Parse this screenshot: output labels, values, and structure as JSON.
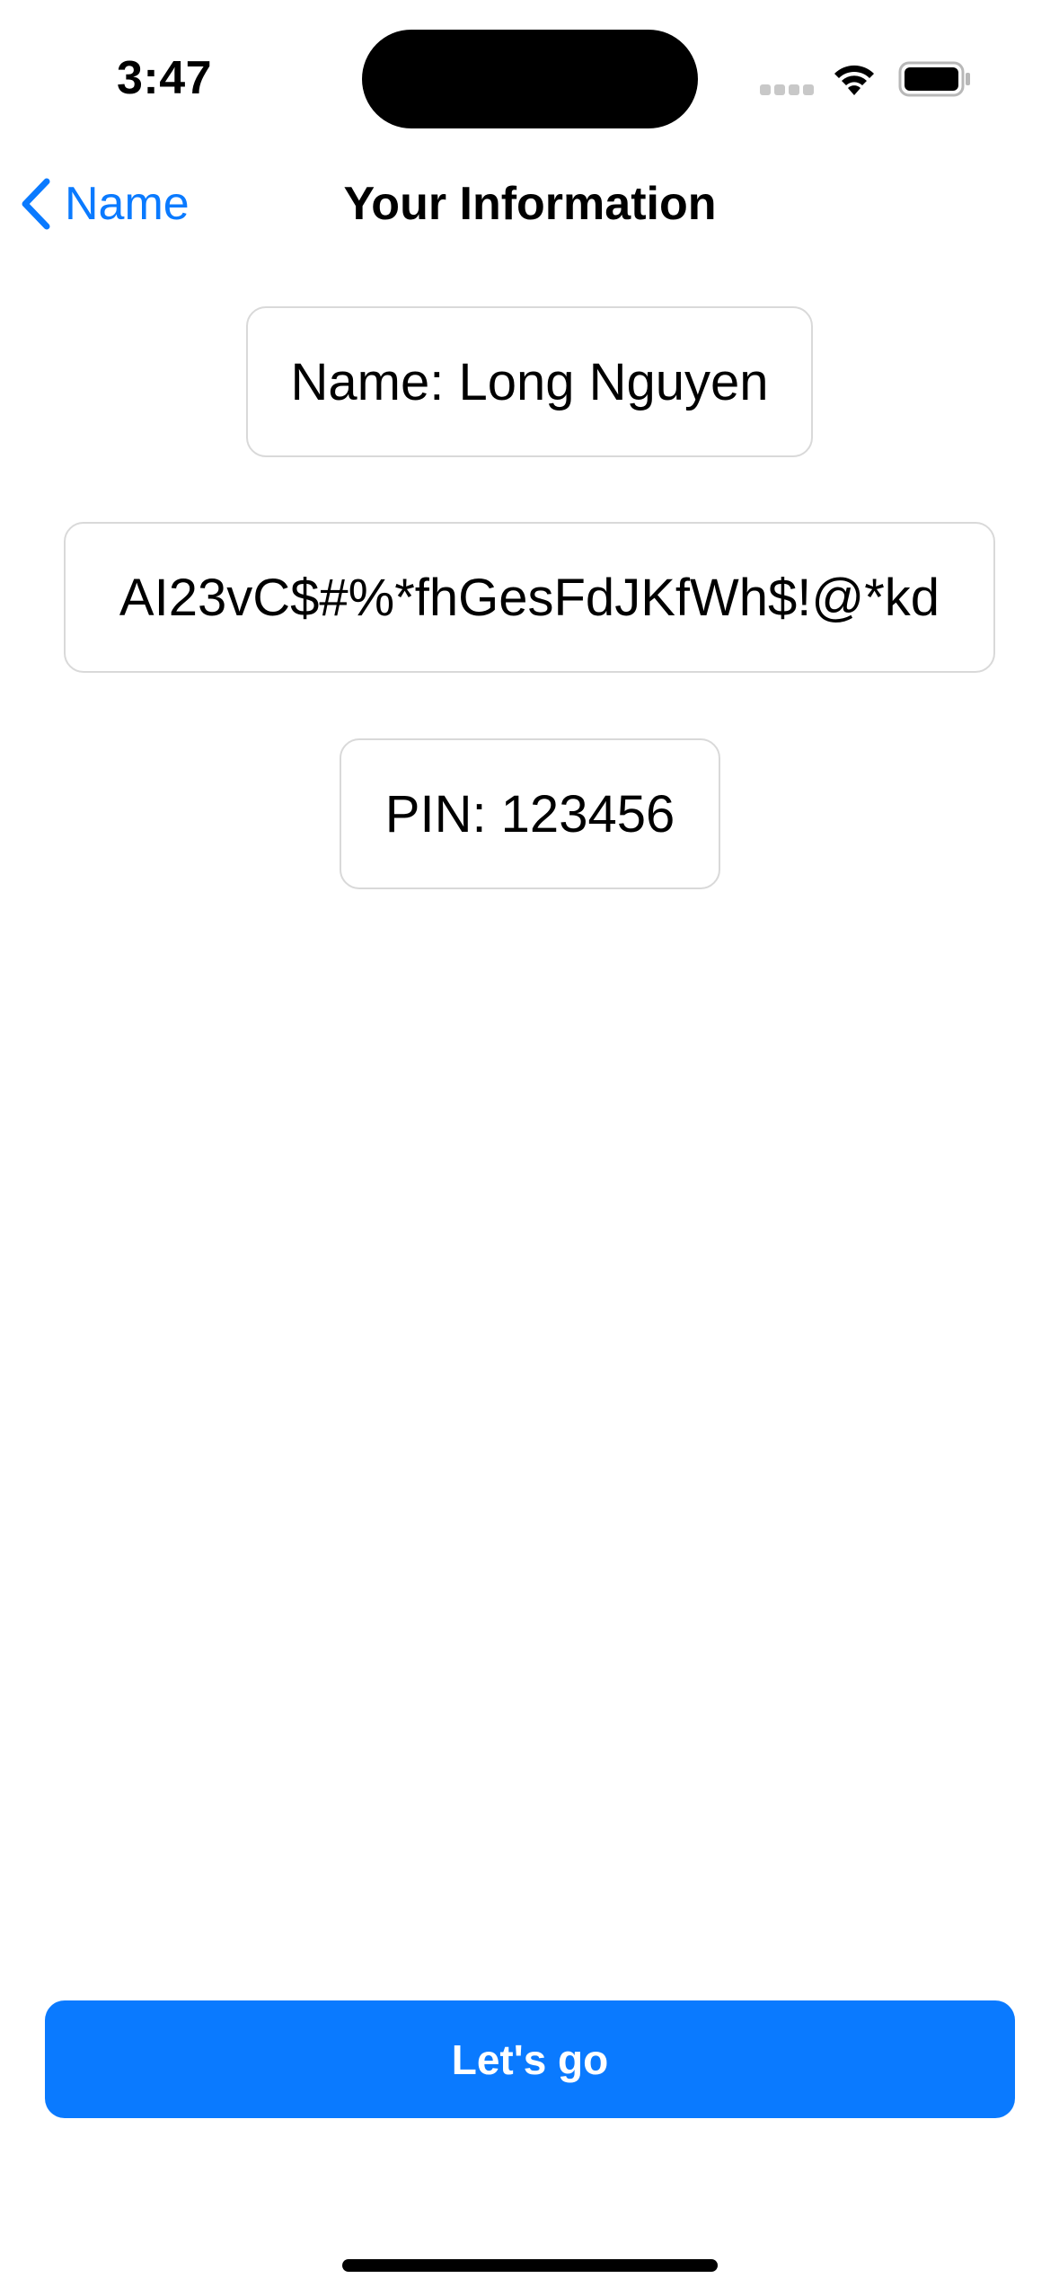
{
  "status_bar": {
    "time": "3:47",
    "icons": [
      "cellular-signal-icon",
      "wifi-icon",
      "battery-icon"
    ]
  },
  "nav": {
    "back_label": "Name",
    "back_icon": "chevron-left-icon",
    "title": "Your Information"
  },
  "info": {
    "name": "Name: Long Nguyen",
    "password": "AI23vC$#%*fhGesFdJKfWh$!@*kd",
    "pin": "PIN: 123456"
  },
  "actions": {
    "primary_label": "Let's go"
  },
  "colors": {
    "accent": "#0a7aff",
    "background": "#ffffff",
    "border": "#d9d9d9",
    "text": "#000000"
  }
}
